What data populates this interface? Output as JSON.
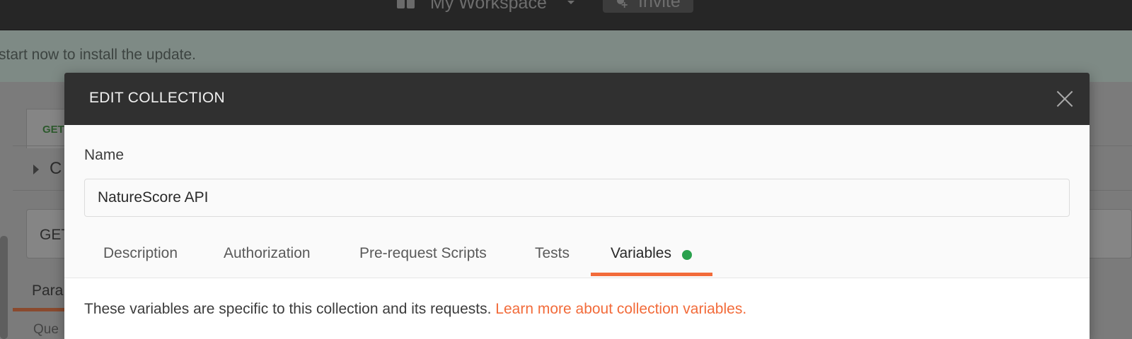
{
  "header": {
    "workspace_name": "My Workspace",
    "invite_label": "Invite"
  },
  "update_banner": {
    "text": "start now to install the update."
  },
  "background_app": {
    "tab_method": "GET",
    "collapse_label": "C",
    "url_method": "GET",
    "params_label": "Para",
    "query_label": "Que"
  },
  "modal": {
    "title": "EDIT COLLECTION",
    "name_label": "Name",
    "name_value": "NatureScore API",
    "tabs": [
      {
        "label": "Description"
      },
      {
        "label": "Authorization"
      },
      {
        "label": "Pre-request Scripts"
      },
      {
        "label": "Tests"
      },
      {
        "label": "Variables"
      }
    ],
    "active_tab": "Variables",
    "info_text": "These variables are specific to this collection and its requests. ",
    "learn_more_link": "Learn more about collection variables."
  },
  "colors": {
    "accent": "#f26b3a",
    "status_dot": "#2aa14d",
    "modal_header": "#303030"
  }
}
